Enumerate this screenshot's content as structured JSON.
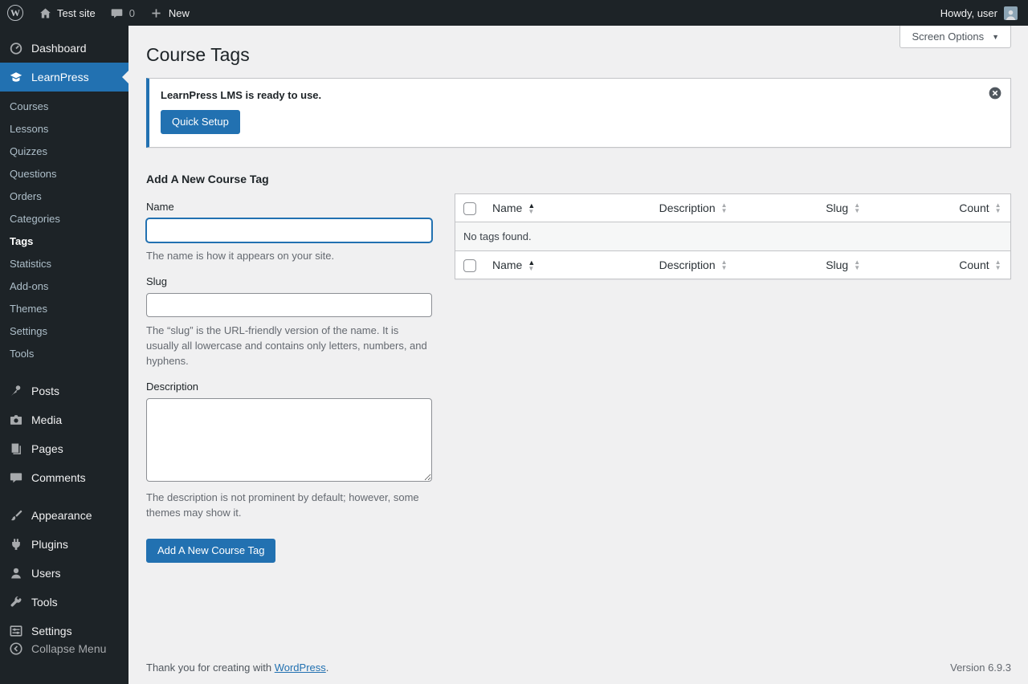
{
  "colors": {
    "accent": "#2271b1",
    "sidebar_bg": "#1d2327",
    "content_bg": "#f0f0f1",
    "notice_border": "#2271b1"
  },
  "admin_bar": {
    "site_name": "Test site",
    "comments_count": "0",
    "new_label": "New",
    "howdy": "Howdy, user"
  },
  "sidebar": {
    "dashboard": "Dashboard",
    "learnpress": "LearnPress",
    "learnpress_submenu": [
      "Courses",
      "Lessons",
      "Quizzes",
      "Questions",
      "Orders",
      "Categories",
      "Tags",
      "Statistics",
      "Add-ons",
      "Themes",
      "Settings",
      "Tools"
    ],
    "posts": "Posts",
    "media": "Media",
    "pages": "Pages",
    "comments": "Comments",
    "appearance": "Appearance",
    "plugins": "Plugins",
    "users": "Users",
    "tools": "Tools",
    "settings": "Settings",
    "collapse": "Collapse Menu"
  },
  "icons": {
    "wordpress_logo": "circled-W",
    "home": "house",
    "comments": "speech-bubble",
    "new": "plus",
    "dashboard": "gauge",
    "learnpress": "graduation-cap",
    "posts": "pushpin",
    "media": "camera",
    "pages": "stacked-pages",
    "appearance": "paintbrush",
    "plugins": "plug",
    "users": "person",
    "tools": "wrench",
    "settings": "control-panel",
    "collapse": "circle-arrow-left",
    "dismiss": "circle-x",
    "screen_options_arrow": "down-triangle",
    "sort_asc": "up-triangle",
    "sort_desc": "down-triangle"
  },
  "screen_options": {
    "label": "Screen Options"
  },
  "page": {
    "title": "Course Tags"
  },
  "notice": {
    "message": "LearnPress LMS is ready to use.",
    "button": "Quick Setup"
  },
  "form": {
    "heading": "Add A New Course Tag",
    "name_label": "Name",
    "name_value": "",
    "name_help": "The name is how it appears on your site.",
    "slug_label": "Slug",
    "slug_value": "",
    "slug_help": "The “slug” is the URL-friendly version of the name. It is usually all lowercase and contains only letters, numbers, and hyphens.",
    "description_label": "Description",
    "description_value": "",
    "description_help": "The description is not prominent by default; however, some themes may show it.",
    "submit": "Add A New Course Tag"
  },
  "table": {
    "columns": [
      "Name",
      "Description",
      "Slug",
      "Count"
    ],
    "empty": "No tags found."
  },
  "footer": {
    "thanks_prefix": "Thank you for creating with ",
    "link": "WordPress",
    "suffix": ".",
    "version": "Version 6.9.3"
  }
}
